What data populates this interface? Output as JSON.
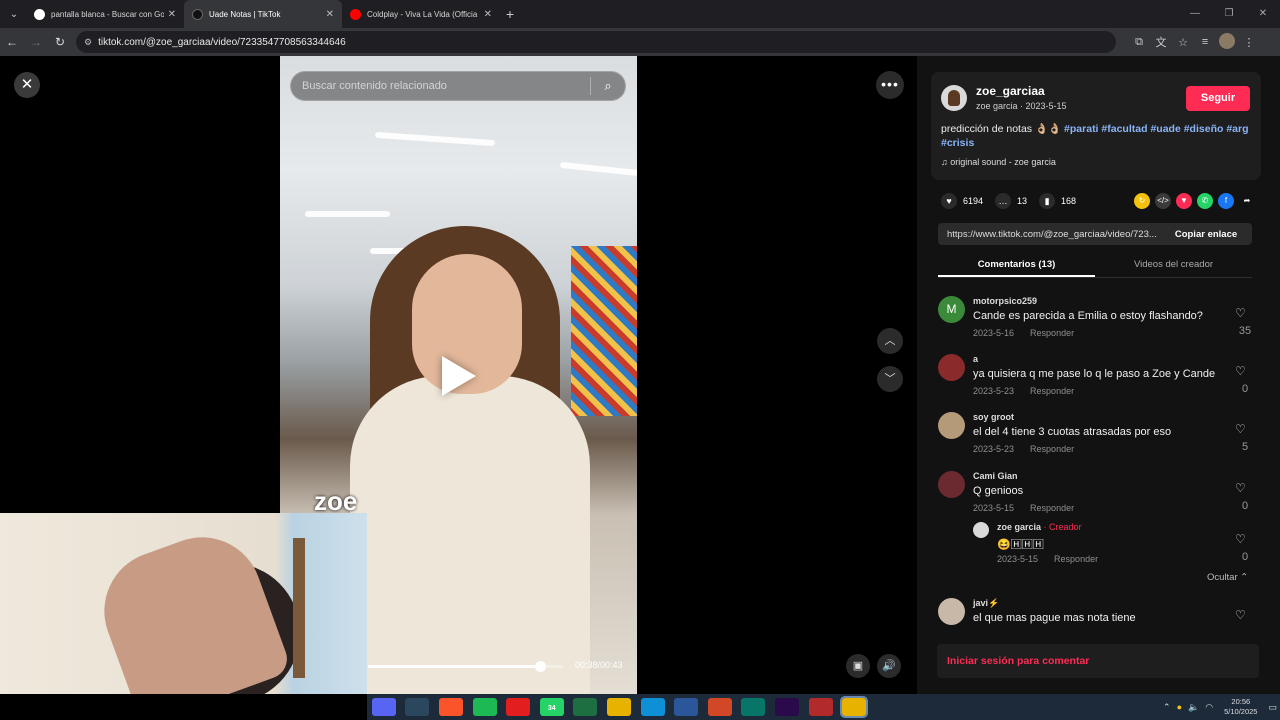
{
  "browser": {
    "tabs": [
      {
        "title": "pantalla blanca - Buscar con Go",
        "favicon_color": "#ffffff",
        "active": false
      },
      {
        "title": "Uade Notas | TikTok",
        "favicon_color": "#111111",
        "active": true
      },
      {
        "title": "Coldplay - Viva La Vida (Officia",
        "favicon_color": "#ff0000",
        "active": false
      }
    ],
    "new_tab": "+",
    "url": "tiktok.com/@zoe_garciaa/video/7233547708563344646"
  },
  "video": {
    "search_placeholder": "Buscar contenido relacionado",
    "overlay_text": "zoe",
    "time": "00:38/00:43",
    "progress_fraction": 0.88
  },
  "creator": {
    "handle": "zoe_garciaa",
    "sub": "zoe garcia · 2023-5-15",
    "follow_label": "Seguir",
    "description_plain": "predicción de notas 👌🏼👌🏼",
    "hashtags": [
      "#parati",
      "#facultad",
      "#uade",
      "#diseño",
      "#arg",
      "#crisis"
    ],
    "sound": "original sound - zoe garcia"
  },
  "stats": {
    "likes": "6194",
    "comments": "13",
    "saves": "168"
  },
  "share_colors": [
    "#f4c20d",
    "#3a3a3a",
    "#fe2c55",
    "#25d366",
    "#1877f2"
  ],
  "link": {
    "url": "https://www.tiktok.com/@zoe_garciaa/video/723...",
    "copy_label": "Copiar enlace"
  },
  "panel_tabs": {
    "comments": "Comentarios (13)",
    "creator_videos": "Videos del creador"
  },
  "comments": [
    {
      "user": "motorpsico259",
      "text": "Cande es parecida a Emilia o estoy flashando?",
      "date": "2023-5-16",
      "reply": "Responder",
      "likes": "35",
      "avatar_color": "#3a8a3a",
      "avatar_letter": "M"
    },
    {
      "user": "a",
      "text": "ya quisiera q me pase lo q le paso a Zoe y Cande",
      "date": "2023-5-23",
      "reply": "Responder",
      "likes": "0",
      "avatar_color": "#8a2a2a",
      "avatar_letter": ""
    },
    {
      "user": "soy groot",
      "text": "el del 4 tiene 3 cuotas atrasadas por eso",
      "date": "2023-5-23",
      "reply": "Responder",
      "likes": "5",
      "avatar_color": "#b59a7a",
      "avatar_letter": ""
    },
    {
      "user": "Cami Gian",
      "text": "Q genioos",
      "date": "2023-5-15",
      "reply": "Responder",
      "likes": "0",
      "avatar_color": "#6a2a30",
      "avatar_letter": ""
    }
  ],
  "creator_reply": {
    "user": "zoe garcia",
    "badge": "· Creador",
    "text": "😆🄷🄷🄷",
    "date": "2023-5-15",
    "reply": "Responder",
    "likes": "0"
  },
  "hide_label": "Ocultar",
  "last_comment": {
    "user": "javi",
    "text": "el que mas pague mas nota tiene"
  },
  "login_prompt": "Iniciar sesión para comentar",
  "taskbar": {
    "apps": [
      {
        "name": "discord",
        "color": "#5865f2"
      },
      {
        "name": "steam",
        "color": "#2a475e"
      },
      {
        "name": "brave",
        "color": "#fb542b"
      },
      {
        "name": "spotify",
        "color": "#1db954"
      },
      {
        "name": "acrobat",
        "color": "#e21e1e"
      },
      {
        "name": "whatsapp",
        "color": "#25d366",
        "badge": "34"
      },
      {
        "name": "excel",
        "color": "#1d6f42"
      },
      {
        "name": "chrome",
        "color": "#e8b200"
      },
      {
        "name": "edge",
        "color": "#0f8fd6"
      },
      {
        "name": "word",
        "color": "#2b579a"
      },
      {
        "name": "powerpoint",
        "color": "#d24726"
      },
      {
        "name": "publisher",
        "color": "#077568"
      },
      {
        "name": "premiere",
        "color": "#2a0a4a"
      },
      {
        "name": "winrar",
        "color": "#b22a2a"
      },
      {
        "name": "chrome-active",
        "color": "#e8b200"
      }
    ],
    "time": "20:56",
    "date": "5/10/2025"
  }
}
